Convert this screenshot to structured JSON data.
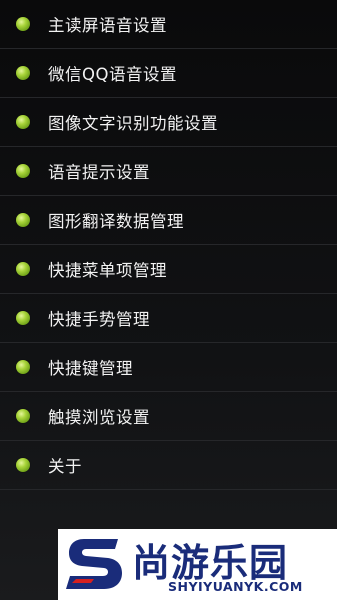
{
  "menu": {
    "items": [
      {
        "label": "主读屏语音设置"
      },
      {
        "label": "微信QQ语音设置"
      },
      {
        "label": "图像文字识别功能设置"
      },
      {
        "label": "语音提示设置"
      },
      {
        "label": "图形翻译数据管理"
      },
      {
        "label": "快捷菜单项管理"
      },
      {
        "label": "快捷手势管理"
      },
      {
        "label": "快捷键管理"
      },
      {
        "label": "触摸浏览设置"
      },
      {
        "label": "关于"
      }
    ]
  },
  "watermark": {
    "title": "尚游乐园",
    "subtitle": "SHYIYUANYK.COM"
  },
  "colors": {
    "bullet": "#8cc63f",
    "watermark_text": "#1a2c7a"
  }
}
